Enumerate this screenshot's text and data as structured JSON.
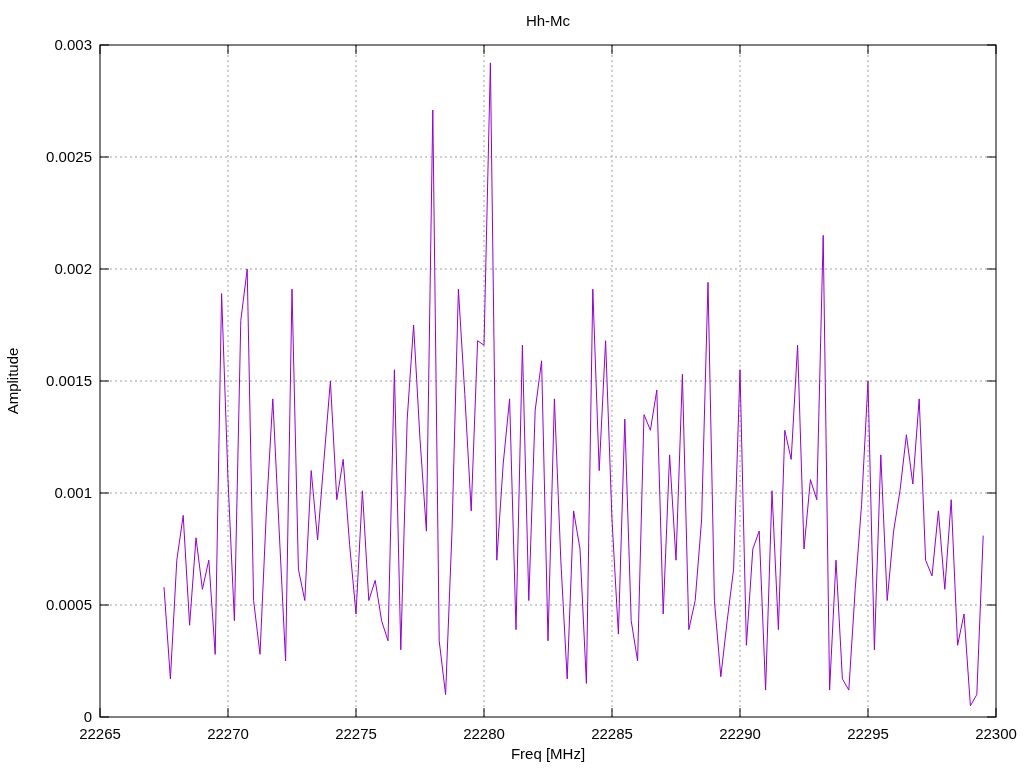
{
  "chart_data": {
    "type": "line",
    "title": "Hh-Mc",
    "xlabel": "Freq [MHz]",
    "ylabel": "Amplitude",
    "xlim": [
      22265,
      22300
    ],
    "grid": true,
    "ylim": [
      0,
      0.003
    ],
    "xticks": [
      22265,
      22270,
      22275,
      22280,
      22285,
      22290,
      22295,
      22300
    ],
    "yticks": [
      0,
      0.0005,
      0.001,
      0.0015,
      0.002,
      0.0025,
      0.003
    ],
    "x": [
      22267.5,
      22267.75,
      22268,
      22268.25,
      22268.5,
      22268.75,
      22269,
      22269.25,
      22269.5,
      22269.75,
      22270,
      22270.25,
      22270.5,
      22270.75,
      22271,
      22271.25,
      22271.5,
      22271.75,
      22272,
      22272.25,
      22272.5,
      22272.75,
      22273,
      22273.25,
      22273.5,
      22273.75,
      22274,
      22274.25,
      22274.5,
      22274.75,
      22275,
      22275.25,
      22275.5,
      22275.75,
      22276,
      22276.25,
      22276.5,
      22276.75,
      22277,
      22277.25,
      22277.5,
      22277.75,
      22278,
      22278.25,
      22278.5,
      22278.75,
      22279,
      22279.25,
      22279.5,
      22279.75,
      22280,
      22280.25,
      22280.5,
      22280.75,
      22281,
      22281.25,
      22281.5,
      22281.75,
      22282,
      22282.25,
      22282.5,
      22282.75,
      22283,
      22283.25,
      22283.5,
      22283.75,
      22284,
      22284.25,
      22284.5,
      22284.75,
      22285,
      22285.25,
      22285.5,
      22285.75,
      22286,
      22286.25,
      22286.5,
      22286.75,
      22287,
      22287.25,
      22287.5,
      22287.75,
      22288,
      22288.25,
      22288.5,
      22288.75,
      22289,
      22289.25,
      22289.5,
      22289.75,
      22290,
      22290.25,
      22290.5,
      22290.75,
      22291,
      22291.25,
      22291.5,
      22291.75,
      22292,
      22292.25,
      22292.5,
      22292.75,
      22293,
      22293.25,
      22293.5,
      22293.75,
      22294,
      22294.25,
      22294.5,
      22294.75,
      22295,
      22295.25,
      22295.5,
      22295.75,
      22296,
      22296.25,
      22296.5,
      22296.75,
      22297,
      22297.25,
      22297.5,
      22297.75,
      22298,
      22298.25,
      22298.5,
      22298.75,
      22299,
      22299.25,
      22299.5
    ],
    "series": [
      {
        "color": "#9400d3",
        "values": [
          0.00058,
          0.00017,
          0.0007,
          0.0009,
          0.00041,
          0.0008,
          0.00057,
          0.0007,
          0.00028,
          0.00189,
          0.00106,
          0.00043,
          0.00177,
          0.002,
          0.00052,
          0.00028,
          0.00092,
          0.00142,
          0.00083,
          0.00025,
          0.00191,
          0.00066,
          0.00052,
          0.0011,
          0.00079,
          0.00115,
          0.0015,
          0.00097,
          0.00115,
          0.00077,
          0.00046,
          0.00101,
          0.00052,
          0.00061,
          0.00043,
          0.00034,
          0.00155,
          0.0003,
          0.00133,
          0.00175,
          0.00124,
          0.00083,
          0.00271,
          0.00034,
          0.0001,
          0.00083,
          0.00191,
          0.00144,
          0.00092,
          0.00168,
          0.00166,
          0.00292,
          0.0007,
          0.00113,
          0.00142,
          0.00039,
          0.00166,
          0.00052,
          0.00137,
          0.00159,
          0.00034,
          0.00142,
          0.0007,
          0.00017,
          0.00092,
          0.00075,
          0.00015,
          0.00191,
          0.0011,
          0.00168,
          0.00088,
          0.00037,
          0.00133,
          0.00043,
          0.00025,
          0.00135,
          0.00128,
          0.00146,
          0.00046,
          0.00117,
          0.0007,
          0.00153,
          0.00039,
          0.00052,
          0.00088,
          0.00194,
          0.00052,
          0.00018,
          0.00043,
          0.00066,
          0.00155,
          0.00032,
          0.00075,
          0.00083,
          0.00012,
          0.00101,
          0.00039,
          0.00128,
          0.00115,
          0.00166,
          0.00075,
          0.00106,
          0.00097,
          0.00215,
          0.00012,
          0.0007,
          0.00017,
          0.00012,
          0.00057,
          0.00095,
          0.0015,
          0.0003,
          0.00117,
          0.00052,
          0.00083,
          0.00101,
          0.00126,
          0.00104,
          0.00142,
          0.0007,
          0.00063,
          0.00092,
          0.00057,
          0.00097,
          0.00032,
          0.00046,
          5e-05,
          0.0001,
          0.00081
        ]
      }
    ]
  }
}
